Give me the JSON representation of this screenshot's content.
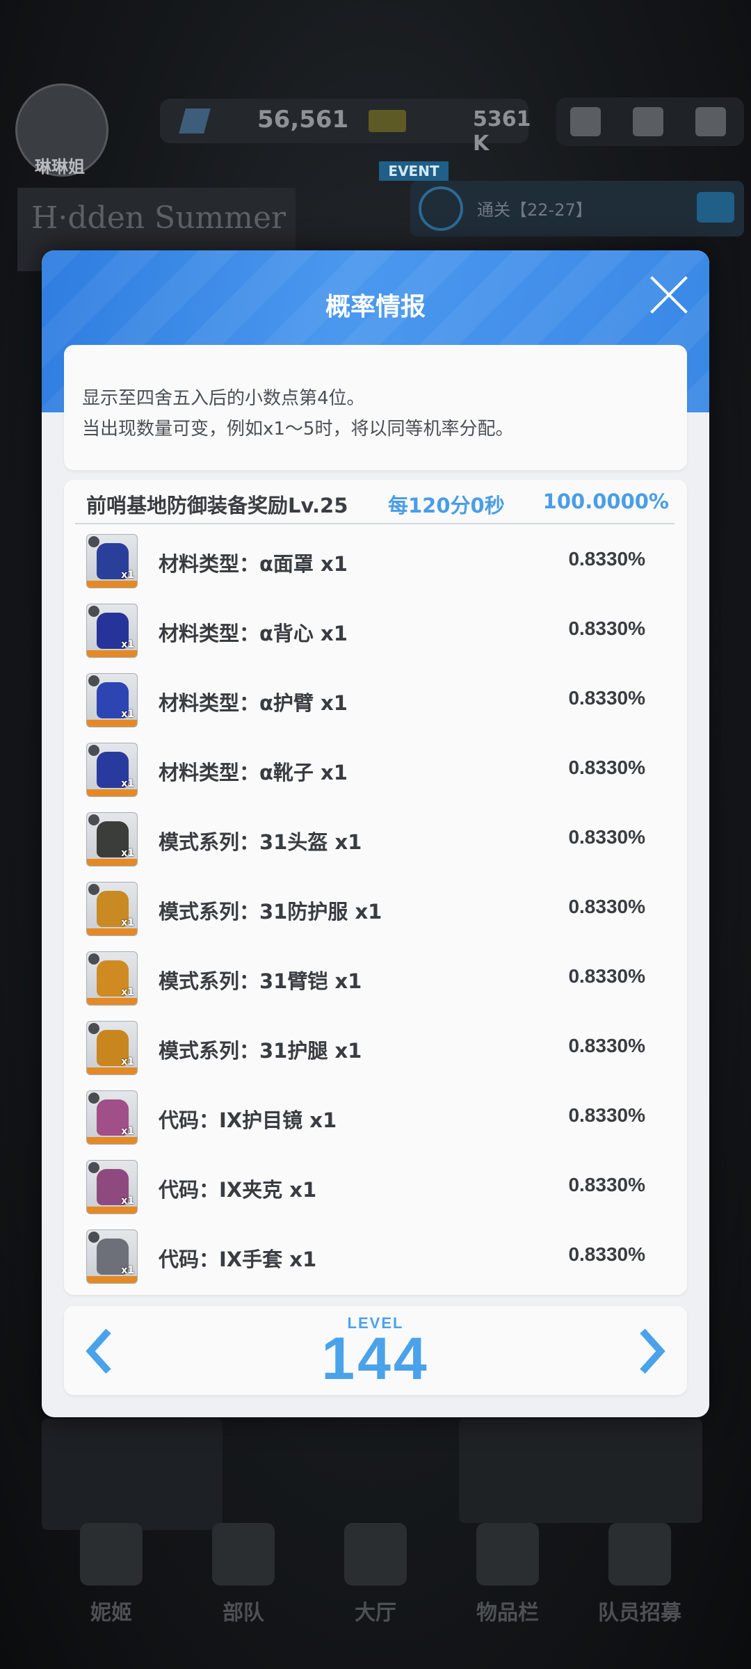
{
  "background": {
    "player_name": "琳琳姐",
    "currency_1": "56,561",
    "currency_2": "5361 K",
    "event_tag": "EVENT",
    "event_text": "通关【22-27】",
    "nav": [
      "妮姬",
      "部队",
      "大厅",
      "物品栏",
      "队员招募"
    ]
  },
  "modal": {
    "title": "概率情报",
    "notice": [
      "显示至四舍五入后的小数点第4位。",
      "当出现数量可变，例如x1～5时，将以同等机率分配。"
    ],
    "header": {
      "title": "前哨基地防御装备奖励Lv.25",
      "interval": "每120分0秒",
      "total": "100.0000%"
    },
    "items": [
      {
        "name": "材料类型：α面罩 x1",
        "rate": "0.8330%",
        "qty": "x1",
        "icon": "helmet-icon",
        "color": "#2a3f9a"
      },
      {
        "name": "材料类型：α背心 x1",
        "rate": "0.8330%",
        "qty": "x1",
        "icon": "vest-icon",
        "color": "#26349a"
      },
      {
        "name": "材料类型：α护臂 x1",
        "rate": "0.8330%",
        "qty": "x1",
        "icon": "gauntlet-icon",
        "color": "#2d44b3"
      },
      {
        "name": "材料类型：α靴子 x1",
        "rate": "0.8330%",
        "qty": "x1",
        "icon": "boots-icon",
        "color": "#293a9f"
      },
      {
        "name": "模式系列：31头盔 x1",
        "rate": "0.8330%",
        "qty": "x1",
        "icon": "helmet-icon",
        "color": "#3b3d3a"
      },
      {
        "name": "模式系列：31防护服 x1",
        "rate": "0.8330%",
        "qty": "x1",
        "icon": "armor-icon",
        "color": "#c98a24"
      },
      {
        "name": "模式系列：31臂铠 x1",
        "rate": "0.8330%",
        "qty": "x1",
        "icon": "gauntlet-icon",
        "color": "#d08a22"
      },
      {
        "name": "模式系列：31护腿 x1",
        "rate": "0.8330%",
        "qty": "x1",
        "icon": "boots-icon",
        "color": "#c9861f"
      },
      {
        "name": "代码：IX护目镜 x1",
        "rate": "0.8330%",
        "qty": "x1",
        "icon": "goggles-icon",
        "color": "#a14f88"
      },
      {
        "name": "代码：IX夹克 x1",
        "rate": "0.8330%",
        "qty": "x1",
        "icon": "jacket-icon",
        "color": "#8e4a7f"
      },
      {
        "name": "代码：IX手套 x1",
        "rate": "0.8330%",
        "qty": "x1",
        "icon": "glove-icon",
        "color": "#6d7078"
      }
    ],
    "pager": {
      "level_label": "LEVEL",
      "level": "144"
    }
  }
}
